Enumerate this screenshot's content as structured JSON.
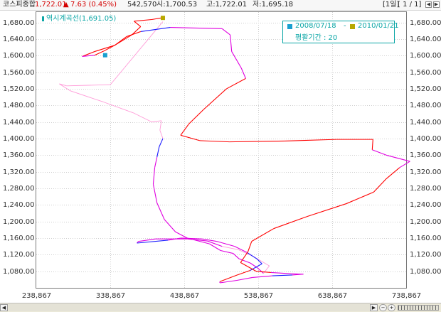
{
  "header": {
    "name": "코스피종합",
    "price": "1,722.01",
    "arrow": "▲",
    "change": "7.63 (0.45%)",
    "volume": "542,570",
    "open": "시:1,700.53",
    "high": "고:1,722.01",
    "low": "저:1,695.18",
    "period": "[1일]",
    "page": "[ 1 / 1]"
  },
  "legend_top": "역시계곡선(1,691.05)",
  "info_box": {
    "start_date": "2008/07/18",
    "dash": "-",
    "end_date": "2010/01/21",
    "period_label": "평활기간 : 20"
  },
  "colors": {
    "up": "#ff0000",
    "down": "#1a1aff",
    "flat": "#e000e0",
    "early": "#ff9ad8",
    "start_marker": "#1aa0d0",
    "end_marker": "#b8a800",
    "accent": "#0aa6a6"
  },
  "chart_data": {
    "type": "scatter",
    "title": "역시계곡선(1,691.05)",
    "xlabel": "",
    "ylabel": "",
    "xlim": [
      238867,
      738867
    ],
    "ylim": [
      1040,
      1705
    ],
    "x_ticks": [
      "238,867",
      "338,867",
      "438,867",
      "538,867",
      "638,867",
      "738,867"
    ],
    "x_tick_values": [
      238867,
      338867,
      438867,
      538867,
      638867,
      738867
    ],
    "y_ticks": [
      "1,080.00",
      "1,120.00",
      "1,160.00",
      "1,200.00",
      "1,240.00",
      "1,280.00",
      "1,320.00",
      "1,360.00",
      "1,400.00",
      "1,440.00",
      "1,480.00",
      "1,520.00",
      "1,560.00",
      "1,600.00",
      "1,640.00",
      "1,680.00"
    ],
    "y_tick_values": [
      1080,
      1120,
      1160,
      1200,
      1240,
      1280,
      1320,
      1360,
      1400,
      1440,
      1480,
      1520,
      1560,
      1600,
      1640,
      1680
    ],
    "grid": true,
    "start": {
      "date": "2008/07/18"
    },
    "end": {
      "date": "2010/01/21"
    },
    "smoothing_period": 20,
    "current": 1691.05,
    "path": [
      {
        "x": 410000,
        "y": 1682,
        "c": "early"
      },
      {
        "x": 339000,
        "y": 1530,
        "c": "early"
      },
      {
        "x": 280000,
        "y": 1527,
        "c": "early"
      },
      {
        "x": 270000,
        "y": 1532,
        "c": "early"
      },
      {
        "x": 285000,
        "y": 1515,
        "c": "early"
      },
      {
        "x": 330000,
        "y": 1488,
        "c": "early"
      },
      {
        "x": 370000,
        "y": 1462,
        "c": "early"
      },
      {
        "x": 395000,
        "y": 1440,
        "c": "early"
      },
      {
        "x": 408000,
        "y": 1443,
        "c": "early"
      },
      {
        "x": 406000,
        "y": 1420,
        "c": "early"
      },
      {
        "x": 410000,
        "y": 1400,
        "c": "early"
      },
      {
        "x": 405000,
        "y": 1380,
        "c": "down"
      },
      {
        "x": 402000,
        "y": 1355,
        "c": "down"
      },
      {
        "x": 399000,
        "y": 1330,
        "c": "flat"
      },
      {
        "x": 397000,
        "y": 1290,
        "c": "flat"
      },
      {
        "x": 402000,
        "y": 1245,
        "c": "flat"
      },
      {
        "x": 412000,
        "y": 1205,
        "c": "flat"
      },
      {
        "x": 427000,
        "y": 1175,
        "c": "flat"
      },
      {
        "x": 443000,
        "y": 1160,
        "c": "flat"
      },
      {
        "x": 473000,
        "y": 1146,
        "c": "flat"
      },
      {
        "x": 488000,
        "y": 1130,
        "c": "flat"
      },
      {
        "x": 505000,
        "y": 1123,
        "c": "flat"
      },
      {
        "x": 513000,
        "y": 1110,
        "c": "flat"
      },
      {
        "x": 528000,
        "y": 1100,
        "c": "flat"
      },
      {
        "x": 538000,
        "y": 1088,
        "c": "flat"
      },
      {
        "x": 546000,
        "y": 1075,
        "c": "flat"
      },
      {
        "x": 554000,
        "y": 1093,
        "c": "early"
      },
      {
        "x": 532000,
        "y": 1116,
        "c": "early"
      },
      {
        "x": 512000,
        "y": 1132,
        "c": "early"
      },
      {
        "x": 490000,
        "y": 1140,
        "c": "early"
      },
      {
        "x": 470000,
        "y": 1153,
        "c": "flat"
      },
      {
        "x": 443000,
        "y": 1158,
        "c": "flat"
      },
      {
        "x": 400000,
        "y": 1158,
        "c": "flat"
      },
      {
        "x": 377000,
        "y": 1152,
        "c": "flat"
      },
      {
        "x": 375000,
        "y": 1148,
        "c": "flat"
      },
      {
        "x": 417000,
        "y": 1155,
        "c": "down"
      },
      {
        "x": 434000,
        "y": 1160,
        "c": "flat"
      },
      {
        "x": 463000,
        "y": 1158,
        "c": "flat"
      },
      {
        "x": 483000,
        "y": 1152,
        "c": "flat"
      },
      {
        "x": 507000,
        "y": 1140,
        "c": "flat"
      },
      {
        "x": 524000,
        "y": 1125,
        "c": "flat"
      },
      {
        "x": 537000,
        "y": 1110,
        "c": "down"
      },
      {
        "x": 544000,
        "y": 1098,
        "c": "down"
      },
      {
        "x": 528000,
        "y": 1082,
        "c": "down"
      },
      {
        "x": 509000,
        "y": 1070,
        "c": "red"
      },
      {
        "x": 487000,
        "y": 1055,
        "c": "red"
      },
      {
        "x": 487000,
        "y": 1052,
        "c": "flat"
      },
      {
        "x": 510000,
        "y": 1058,
        "c": "flat"
      },
      {
        "x": 531000,
        "y": 1065,
        "c": "flat"
      },
      {
        "x": 558000,
        "y": 1069,
        "c": "flat"
      },
      {
        "x": 585000,
        "y": 1071,
        "c": "down"
      },
      {
        "x": 600000,
        "y": 1073,
        "c": "flat"
      },
      {
        "x": 584000,
        "y": 1074,
        "c": "flat"
      },
      {
        "x": 556000,
        "y": 1077,
        "c": "flat"
      },
      {
        "x": 536000,
        "y": 1080,
        "c": "red"
      },
      {
        "x": 515000,
        "y": 1101,
        "c": "red"
      },
      {
        "x": 525000,
        "y": 1127,
        "c": "red"
      },
      {
        "x": 530000,
        "y": 1152,
        "c": "red"
      },
      {
        "x": 560000,
        "y": 1183,
        "c": "red"
      },
      {
        "x": 605000,
        "y": 1212,
        "c": "red"
      },
      {
        "x": 658000,
        "y": 1243,
        "c": "red"
      },
      {
        "x": 695000,
        "y": 1271,
        "c": "red"
      },
      {
        "x": 712000,
        "y": 1303,
        "c": "red"
      },
      {
        "x": 730000,
        "y": 1330,
        "c": "red"
      },
      {
        "x": 744000,
        "y": 1345,
        "c": "flat"
      },
      {
        "x": 712000,
        "y": 1360,
        "c": "flat"
      },
      {
        "x": 693000,
        "y": 1373,
        "c": "flat"
      },
      {
        "x": 694000,
        "y": 1398,
        "c": "red"
      },
      {
        "x": 645000,
        "y": 1398,
        "c": "red"
      },
      {
        "x": 574000,
        "y": 1394,
        "c": "red"
      },
      {
        "x": 500000,
        "y": 1392,
        "c": "red"
      },
      {
        "x": 460000,
        "y": 1395,
        "c": "red"
      },
      {
        "x": 434000,
        "y": 1408,
        "c": "red"
      },
      {
        "x": 445000,
        "y": 1435,
        "c": "red"
      },
      {
        "x": 465000,
        "y": 1470,
        "c": "red"
      },
      {
        "x": 496000,
        "y": 1520,
        "c": "red"
      },
      {
        "x": 522000,
        "y": 1545,
        "c": "red"
      },
      {
        "x": 516000,
        "y": 1570,
        "c": "flat"
      },
      {
        "x": 503000,
        "y": 1610,
        "c": "flat"
      },
      {
        "x": 501000,
        "y": 1650,
        "c": "flat"
      },
      {
        "x": 490000,
        "y": 1665,
        "c": "flat"
      },
      {
        "x": 420000,
        "y": 1668,
        "c": "flat"
      },
      {
        "x": 380000,
        "y": 1658,
        "c": "down"
      },
      {
        "x": 361000,
        "y": 1646,
        "c": "red"
      },
      {
        "x": 345000,
        "y": 1625,
        "c": "red"
      },
      {
        "x": 318000,
        "y": 1610,
        "c": "red"
      },
      {
        "x": 301000,
        "y": 1598,
        "c": "red"
      },
      {
        "x": 318000,
        "y": 1601,
        "c": "flat"
      },
      {
        "x": 330000,
        "y": 1611,
        "c": "red"
      },
      {
        "x": 345000,
        "y": 1625,
        "c": "red"
      },
      {
        "x": 368000,
        "y": 1650,
        "c": "red"
      },
      {
        "x": 380000,
        "y": 1670,
        "c": "red"
      },
      {
        "x": 371000,
        "y": 1683,
        "c": "red"
      },
      {
        "x": 395000,
        "y": 1687,
        "c": "red"
      },
      {
        "x": 408000,
        "y": 1691,
        "c": "red"
      }
    ],
    "start_marker": {
      "x": 410000,
      "y": 1691
    },
    "end_marker": {
      "x": 332000,
      "y": 1601
    }
  },
  "scrollbar": {
    "left_arrow": "◀",
    "right_arrow": "▶",
    "zoom_out": "−",
    "zoom_in": "+"
  }
}
